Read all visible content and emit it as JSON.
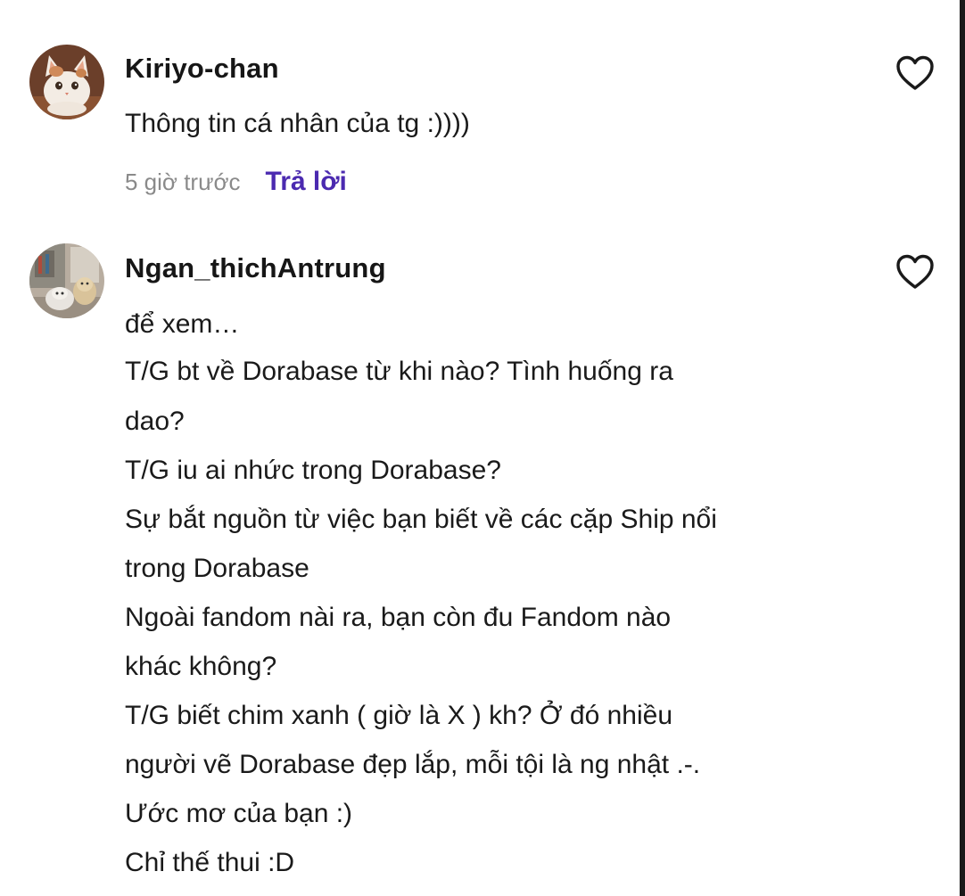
{
  "comments": [
    {
      "username": "Kiriyo-chan",
      "lines": [
        "Thông tin cá nhân của tg :))))"
      ],
      "timestamp": "5 giờ trước",
      "reply_label": "Trả lời",
      "avatar": "cat-avatar"
    },
    {
      "username": "Ngan_thichAntrung",
      "lines": [
        "để xem…",
        "T/G bt về Dorabase từ khi nào? Tình huống ra",
        "dao?",
        "T/G iu ai nhức trong Dorabase?",
        "Sự bắt nguồn từ việc bạn biết về các cặp Ship nổi",
        "trong Dorabase",
        "Ngoài fandom nài ra, bạn còn đu Fandom nào",
        "khác không?",
        "T/G biết chim xanh ( giờ là X ) kh? Ở đó nhiều",
        "người vẽ Dorabase đẹp lắp, mỗi tội là ng nhật .-.",
        "Ước mơ của bạn :)",
        "Chỉ thế thui :D"
      ],
      "avatar": "plush-avatar"
    }
  ],
  "colors": {
    "reply": "#4b2ab0",
    "timestamp": "#8a8a8a",
    "text": "#1a1a1a"
  }
}
